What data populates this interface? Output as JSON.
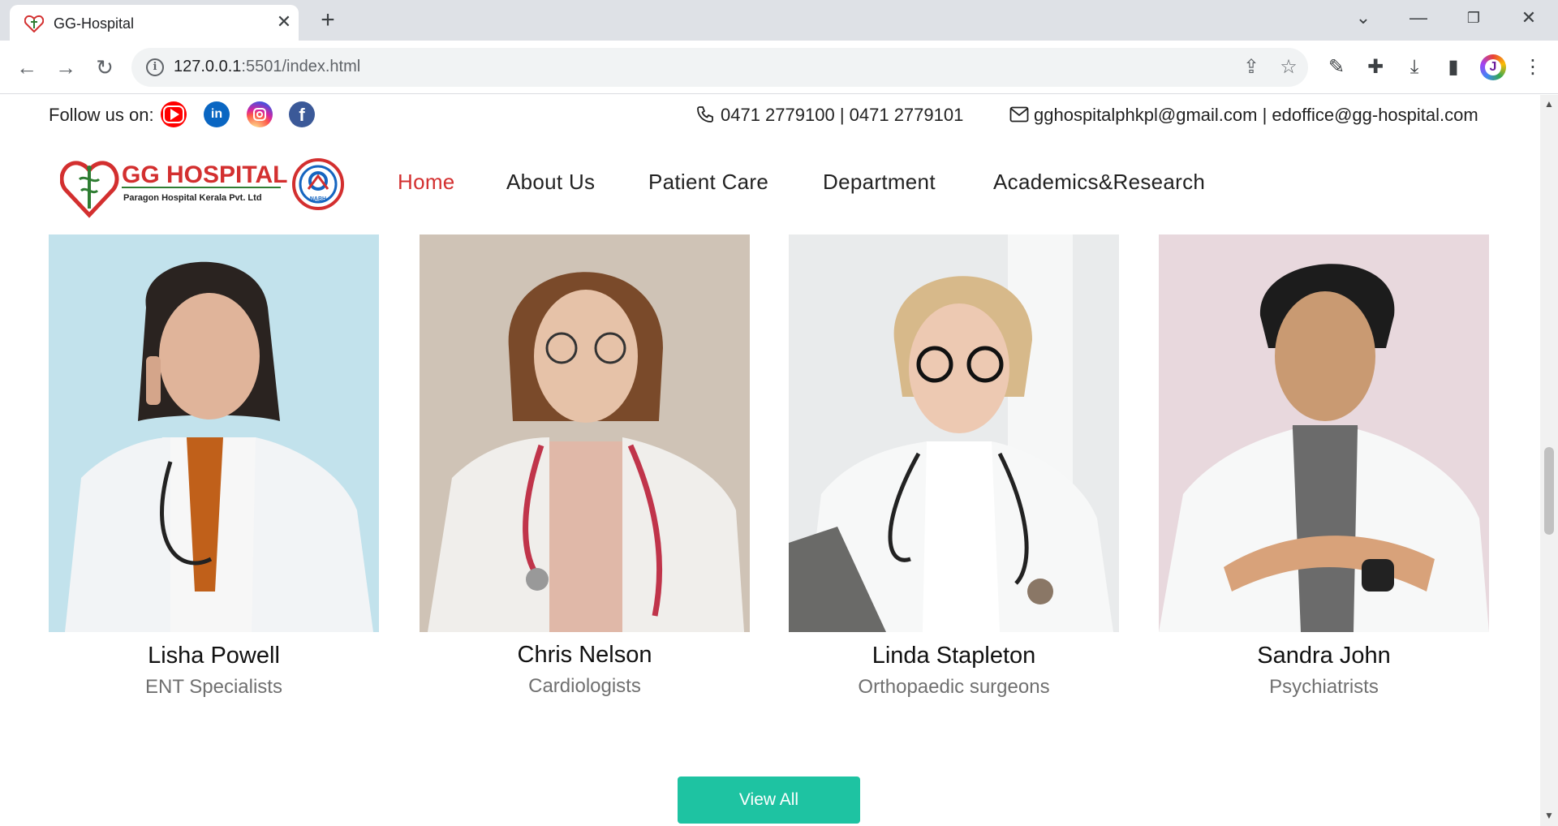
{
  "browser": {
    "tab_title": "GG-Hospital",
    "tab_close": "✕",
    "new_tab": "+",
    "url_host": "127.0.0.1",
    "url_rest": ":5501/index.html"
  },
  "topbar": {
    "follow_label": "Follow us on:",
    "socials": [
      "youtube-icon",
      "linkedin-icon",
      "instagram-icon",
      "facebook-icon"
    ],
    "linkedin_glyph": "in",
    "facebook_glyph": "f",
    "phone": "0471 2779100 | 0471 2779101",
    "email": "gghospitalphkpl@gmail.com | edoffice@gg-hospital.com"
  },
  "logo": {
    "brand": "GG HOSPITAL",
    "tagline": "Paragon Hospital Kerala Pvt. Ltd",
    "seal_text": "NABH"
  },
  "nav": {
    "items": [
      "Home",
      "About Us",
      "Patient Care",
      "Department",
      "Academics&Research"
    ],
    "active": "Home"
  },
  "doctors": [
    {
      "name": "Lisha Powell",
      "role": "ENT Specialists"
    },
    {
      "name": "Chris Nelson",
      "role": "Cardiologists"
    },
    {
      "name": "Linda Stapleton",
      "role": "Orthopaedic surgeons"
    },
    {
      "name": "Sandra John",
      "role": "Psychiatrists"
    }
  ],
  "view_all_label": "View All",
  "colors": {
    "accent_red": "#d32f2f",
    "button_teal": "#1ec3a2",
    "chrome_tabbar": "#dee1e6"
  }
}
